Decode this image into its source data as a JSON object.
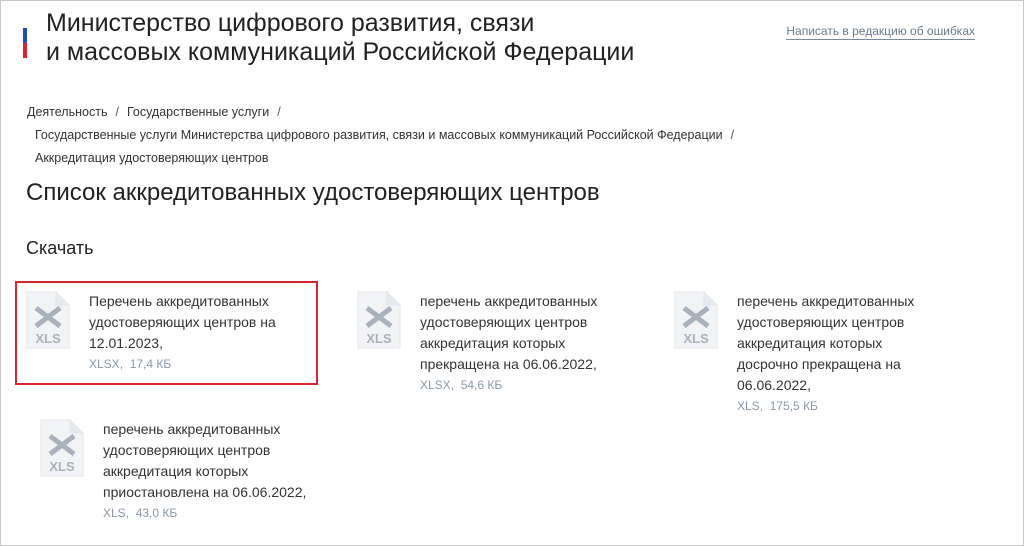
{
  "header": {
    "title_line1": "Министерство цифрового развития, связи",
    "title_line2": "и массовых коммуникаций Российской Федерации",
    "report_link": "Написать в редакцию об ошибках",
    "brand_colors": [
      "#ffffff",
      "#1f4fb3",
      "#d8262e"
    ]
  },
  "breadcrumb": {
    "items": [
      "Деятельность",
      "Государственные услуги",
      "Государственные услуги Министерства цифрового развития, связи и массовых коммуникаций Российской Федерации",
      "Аккредитация удостоверяющих центров"
    ],
    "separator": "/"
  },
  "page_title": "Список аккредитованных удостоверяющих центров",
  "section_title": "Скачать",
  "files": [
    {
      "name": "Перечень аккредитованных удостоверяющих центров на 12.01.2023,",
      "format": "XLSX",
      "size": "17,4 КБ",
      "icon_label": "XLS",
      "highlighted": true
    },
    {
      "name": "перечень аккредитованных удостоверяющих центров аккредитация которых прекращена на 06.06.2022,",
      "format": "XLSX",
      "size": "54,6 КБ",
      "icon_label": "XLS",
      "highlighted": false
    },
    {
      "name": "перечень аккредитованных удостоверяющих центров аккредитация которых досрочно прекращена на 06.06.2022,",
      "format": "XLS",
      "size": "175,5 КБ",
      "icon_label": "XLS",
      "highlighted": false
    },
    {
      "name": "перечень аккредитованных удостоверяющих центров аккредитация которых приостановлена на 06.06.2022,",
      "format": "XLS",
      "size": "43,0 КБ",
      "icon_label": "XLS",
      "highlighted": false
    }
  ],
  "colors": {
    "highlight_border": "#d8262e",
    "meta_text": "#8a97a8",
    "icon_fill": "#f1f3f5",
    "icon_glyph": "#a9b2bc"
  }
}
